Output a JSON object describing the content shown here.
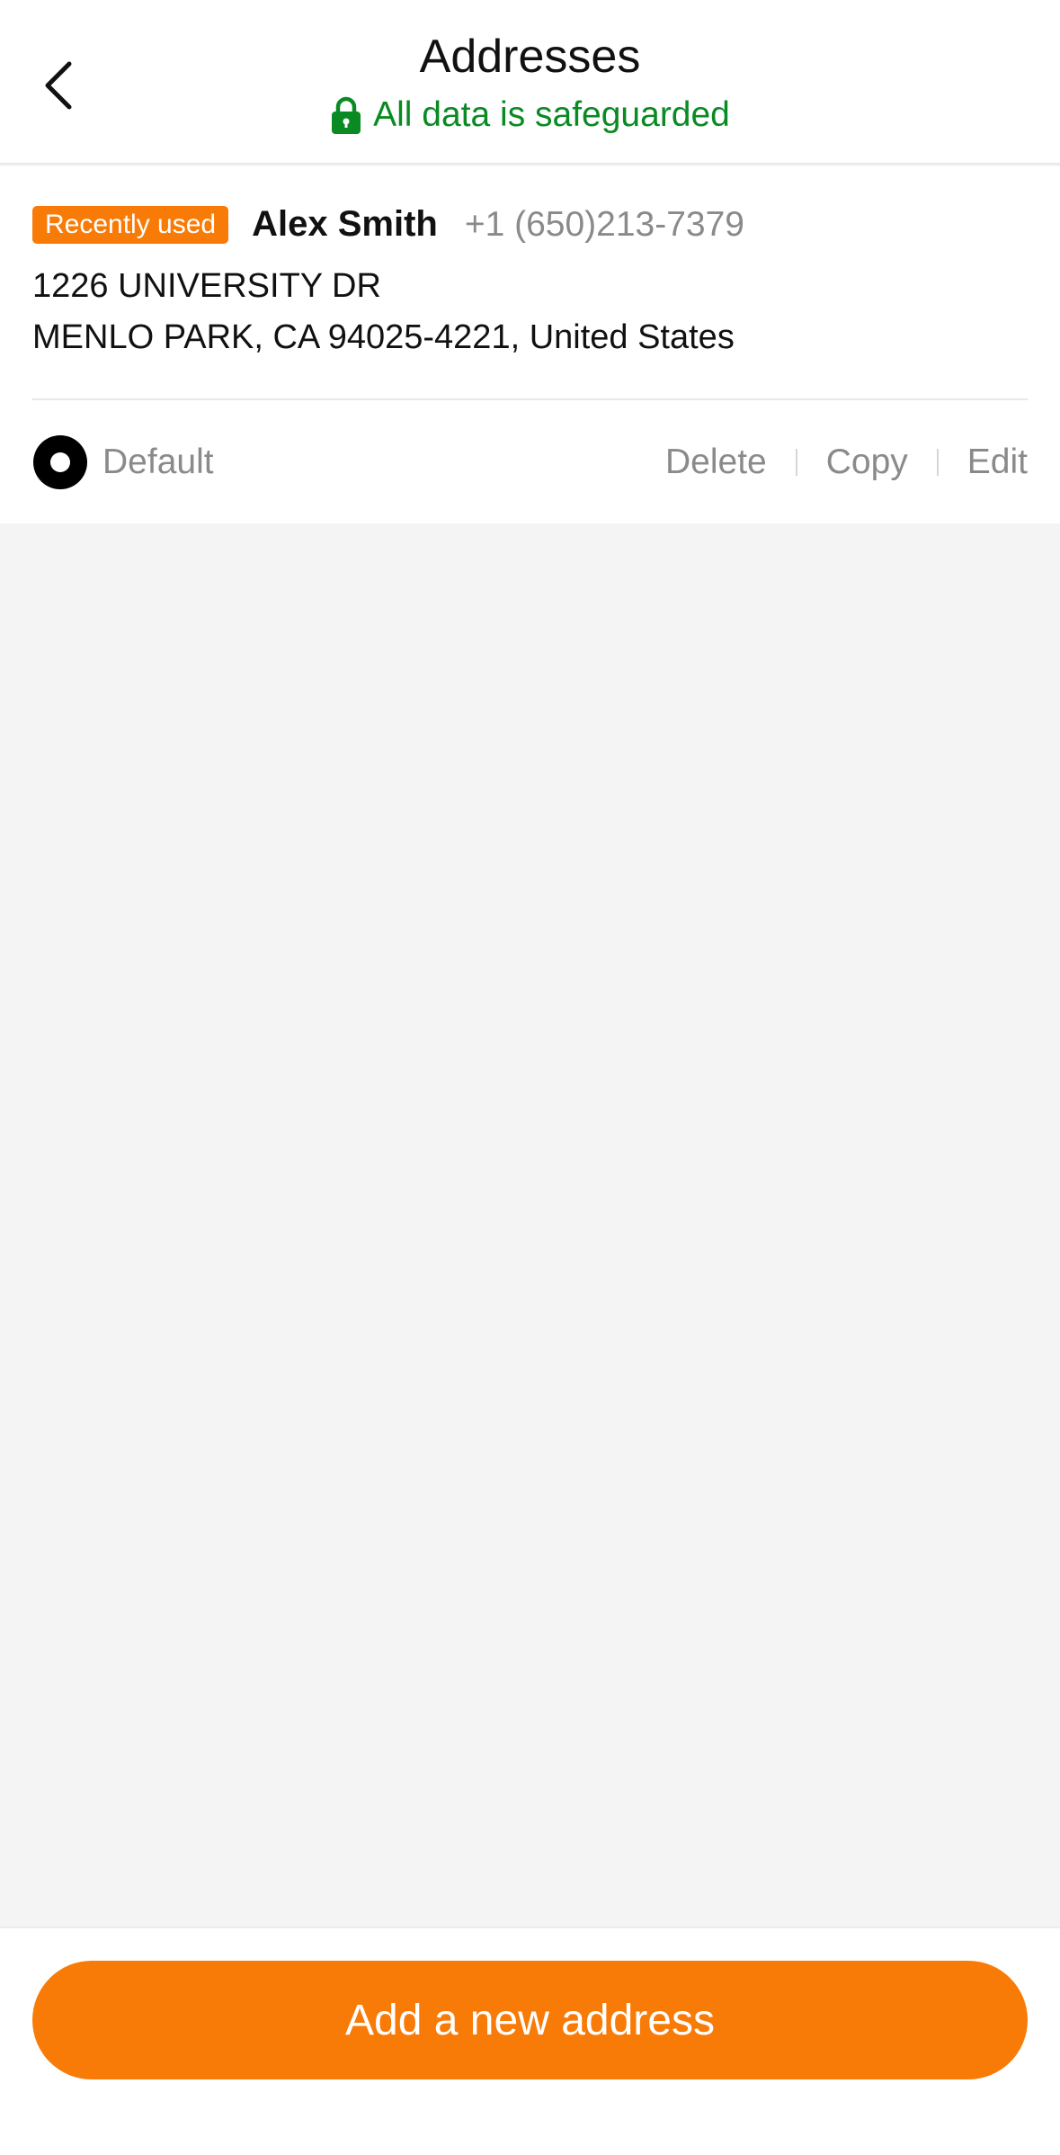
{
  "header": {
    "title": "Addresses",
    "secure_text": "All data is safeguarded",
    "back_icon": "chevron-left-icon",
    "lock_icon": "lock-icon"
  },
  "address": {
    "badge": "Recently used",
    "name": "Alex Smith",
    "phone": "+1 (650)213-7379",
    "line1": "1226 UNIVERSITY DR",
    "line2": "MENLO PARK, CA 94025-4221, United States",
    "default_label": "Default",
    "actions": {
      "delete": "Delete",
      "copy": "Copy",
      "edit": "Edit"
    }
  },
  "footer": {
    "add_button": "Add a new address"
  },
  "colors": {
    "accent": "#f97b07",
    "secure_green": "#0a8a23",
    "muted_text": "#8a8a8a",
    "background": "#f4f4f4"
  }
}
